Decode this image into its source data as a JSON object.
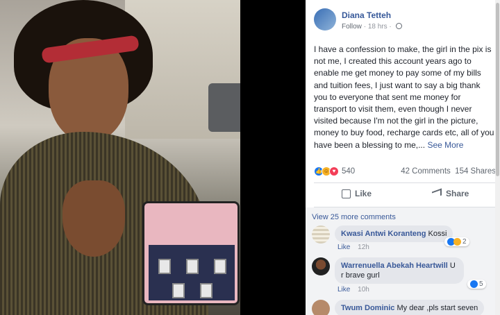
{
  "post": {
    "author": "Diana Tetteh",
    "follow_label": "Follow",
    "separator": "·",
    "time": "18 hrs",
    "separator2": "·",
    "text": "I have a confession to make, the girl in the pix is not me, I created this account years ago to enable me get money to pay some of my bills and tuition fees, I just want to say a big thank you to everyone that sent me money for transport to visit them, even though I never visited because I'm not the girl in the picture, money to buy food, recharge cards etc, all of you have been a blessing to me,...",
    "see_more": "See More",
    "reaction_count": "540",
    "comments_count": "42 Comments",
    "shares_count": "154 Shares",
    "like_label": "Like",
    "share_label": "Share"
  },
  "comments": {
    "view_more": "View 25 more comments",
    "items": [
      {
        "name": "Kwasi Antwi Koranteng",
        "text": "Kossi",
        "like": "Like",
        "time": "12h",
        "reactions": "2"
      },
      {
        "name": "Warrenuella Abekah Heartwill",
        "text": "U r brave gurl",
        "like": "Like",
        "time": "10h",
        "reactions": "5"
      },
      {
        "name": "Twum Dominic",
        "text": "My dear ,pls start seven"
      }
    ]
  },
  "colors": {
    "link": "#385898",
    "accent": "#1877f2",
    "love": "#f33e58"
  }
}
